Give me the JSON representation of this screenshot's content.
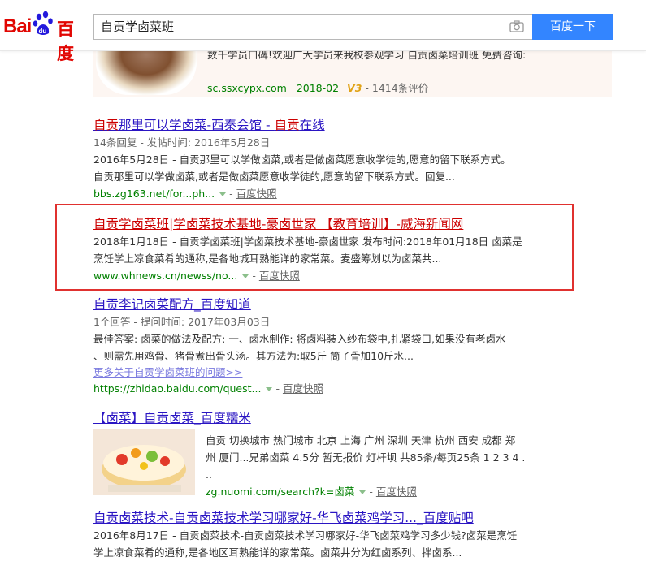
{
  "header": {
    "logo_text_left": "Bai",
    "logo_text_right": "百度",
    "search_value": "自贡学卤菜班",
    "search_button": "百度一下"
  },
  "ad": {
    "text": "数千学员口碑!欢迎广大学员来我校参观学习 自贡卤菜培训班 免费咨询:",
    "url": "sc.ssxcypx.com",
    "date": "2018-02",
    "v3": "V3",
    "reviews": "1414条评价",
    "dash": "-"
  },
  "results": [
    {
      "title_parts": [
        "自贡",
        "那里可以学卤菜-西秦会馆 - ",
        "自贡",
        "在线"
      ],
      "meta": "14条回复 - 发帖时间: 2016年5月28日",
      "abs1": "2016年5月28日 - 自贡那里可以学做卤菜,或者是做卤菜愿意收学徒的,愿意的留下联系方式。",
      "abs2": "自贡那里可以学做卤菜,或者是做卤菜愿意收学徒的,愿意的留下联系方式。回复...",
      "url": "bbs.zg163.net/for...ph...",
      "snapshot": "百度快照"
    },
    {
      "title": "自贡学卤菜班|学卤菜技术基地-豪卤世家 【教育培训】-威海新闻网",
      "abs1": "2018年1月18日 - 自贡学卤菜班|学卤菜技术基地-豪卤世家 发布时间:2018年01月18日 卤菜是",
      "abs2": "烹饪学上凉食菜肴的通称,是各地城耳熟能详的家常菜。麦盛筹划以为卤菜共...",
      "url": "www.whnews.cn/newss/no...",
      "snapshot": "百度快照"
    },
    {
      "title": "自贡李记卤菜配方_百度知道",
      "meta": "1个回答 - 提问时间: 2017年03月03日",
      "abs1": "最佳答案: 卤菜的做法及配方: 一、卤水制作: 将卤料装入纱布袋中,扎紧袋口,如果没有老卤水",
      "abs2": "、则需先用鸡骨、猪骨煮出骨头汤。其方法为:取5斤 筒子骨加10斤水...",
      "more": "更多关于自贡学卤菜班的问题>>",
      "url": "https://zhidao.baidu.com/quest...",
      "snapshot": "百度快照"
    },
    {
      "title": "【卤菜】自贡卤菜_百度糯米",
      "abs1": "自贡 切换城市 热门城市 北京 上海 广州 深圳 天津 杭州 西安 成都 郑",
      "abs2": "州 厦门...兄弟卤菜 4.5分 暂无报价 灯杆坝 共85条/每页25条 1 2 3 4 .",
      "abs3": "..",
      "url": "zg.nuomi.com/search?k=卤菜",
      "snapshot": "百度快照"
    },
    {
      "title": "自贡卤菜技术-自贡卤菜技术学习哪家好-华飞卤菜鸡学习..._百度贴吧",
      "abs1": "2016年8月17日 - 自贡卤菜技术-自贡卤菜技术学习哪家好-华飞卤菜鸡学习多少钱?卤菜是烹饪",
      "abs2": "学上凉食菜肴的通称,是各地区耳熟能详的家常菜。卤菜井分为红卤系列、拌卤系..."
    }
  ],
  "colors": {
    "accent_red": "#e10602",
    "link_blue": "#2a15c3",
    "url_green": "#008000",
    "button_blue": "#3385ff",
    "frame_red": "#e0312f"
  }
}
